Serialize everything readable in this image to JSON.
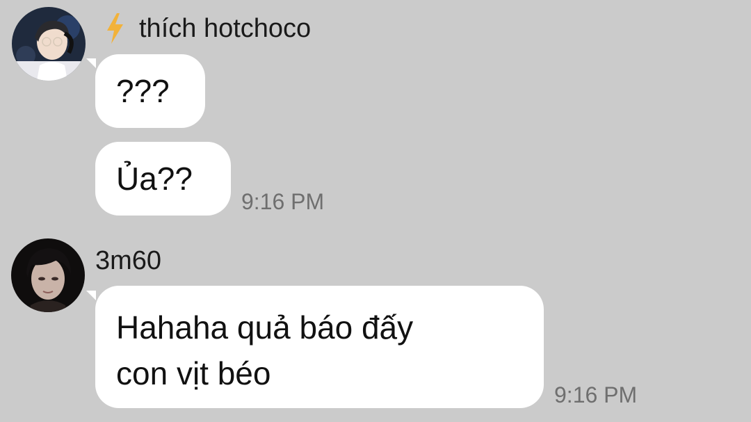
{
  "messages": [
    {
      "sender": "thích hotchoco",
      "sender_icon": "lightning-bolt-icon",
      "avatar": "avatar-thich-hotchoco",
      "bubbles": [
        "???",
        "Ủa??"
      ],
      "time": "9:16 PM"
    },
    {
      "sender": "3m60",
      "avatar": "avatar-3m60",
      "bubbles": [
        "Hahaha quả báo đấy\ncon vịt béo"
      ],
      "time": "9:16 PM"
    }
  ],
  "colors": {
    "background": "#cbcbcb",
    "bubble": "#ffffff",
    "bolt": "#f2b23a",
    "timestamp": "#6f6f6f"
  }
}
